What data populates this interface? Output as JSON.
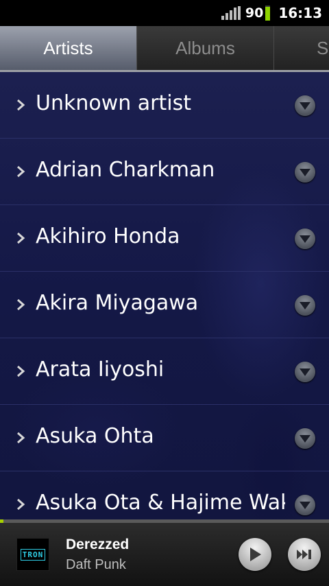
{
  "status": {
    "battery_level": "90",
    "time": "16:13",
    "signal_icon": "signal-icon",
    "battery_icon": "battery-icon",
    "battery_fraction": 0.9
  },
  "tabs": [
    {
      "label": "Artists",
      "active": true
    },
    {
      "label": "Albums",
      "active": false
    },
    {
      "label": "So",
      "active": false
    }
  ],
  "artists": [
    {
      "name": "Unknown artist"
    },
    {
      "name": "Adrian Charkman"
    },
    {
      "name": "Akihiro Honda"
    },
    {
      "name": "Akira Miyagawa"
    },
    {
      "name": "Arata Iiyoshi"
    },
    {
      "name": "Asuka Ohta"
    },
    {
      "name": "Asuka Ota & Hajime Wak"
    }
  ],
  "now_playing": {
    "title": "Derezzed",
    "artist": "Daft Punk",
    "album_art_text": "TRON",
    "progress_fraction": 0.01,
    "play_icon": "play-icon",
    "next_icon": "next-track-icon"
  },
  "colors": {
    "accent": "#a6d000",
    "active_tab": "#7a7f8c"
  }
}
